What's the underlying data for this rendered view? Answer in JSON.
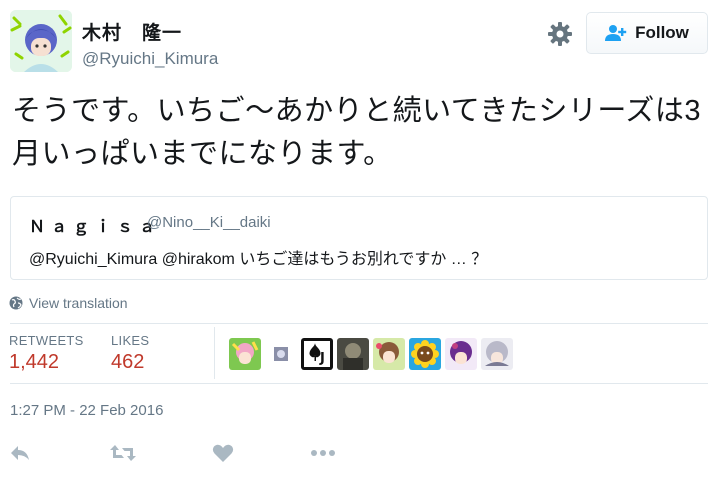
{
  "author": {
    "display_name": "木村　隆一",
    "handle": "@Ryuichi_Kimura",
    "avatar_icon": "user-avatar-icon"
  },
  "header": {
    "settings_icon": "gear-icon",
    "follow_label": "Follow",
    "follow_icon": "add-person-icon"
  },
  "tweet": {
    "text": "そうです。いちご〜あかりと続いてきたシリーズは3月いっぱいまでになります。"
  },
  "quoted_tweet": {
    "display_name": "Ｎａｇｉｓａ",
    "handle": "@Nino__Ki__daiki",
    "text": "@Ryuichi_Kimura @hirakom いちご達はもうお別れですか … ？"
  },
  "translate": {
    "label": "View translation",
    "icon": "globe-icon"
  },
  "stats": {
    "retweets_label": "RETWEETS",
    "retweets_value": "1,442",
    "likes_label": "LIKES",
    "likes_value": "462"
  },
  "likers": [
    {
      "icon": "liker-avatar-1-icon"
    },
    {
      "icon": "liker-avatar-2-icon"
    },
    {
      "icon": "liker-avatar-3-icon"
    },
    {
      "icon": "liker-avatar-4-icon"
    },
    {
      "icon": "liker-avatar-5-icon"
    },
    {
      "icon": "liker-avatar-6-icon"
    },
    {
      "icon": "liker-avatar-7-icon"
    },
    {
      "icon": "liker-avatar-8-icon"
    }
  ],
  "timestamp": "1:27 PM - 22 Feb 2016",
  "actions": {
    "reply_icon": "reply-icon",
    "retweet_icon": "retweet-icon",
    "like_icon": "heart-icon",
    "more_icon": "more-icon"
  },
  "colors": {
    "stat_value": "#c0392b",
    "muted": "#657786",
    "border": "#e1e8ed",
    "accent": "#1da1f2"
  }
}
